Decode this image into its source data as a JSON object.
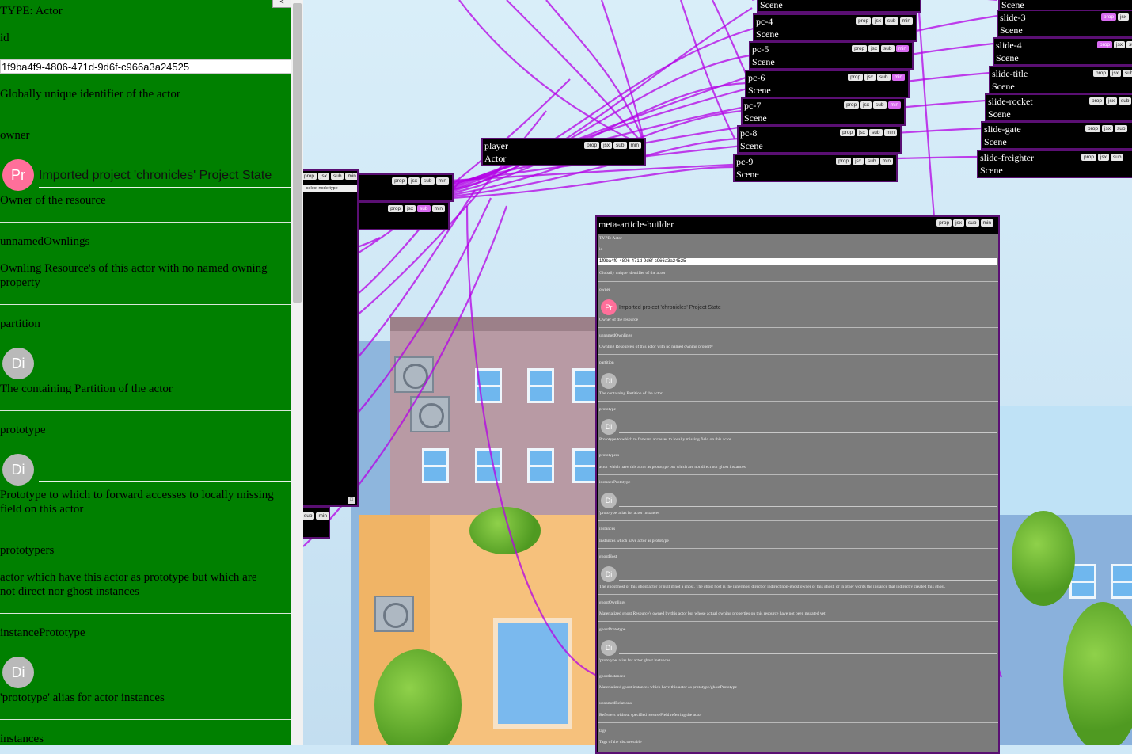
{
  "inspector": {
    "type_label": "TYPE: Actor",
    "collapse_label": "<",
    "id_label": "id",
    "id_value": "1f9ba4f9-4806-471d-9d6f-c966a3a24525",
    "id_desc": "Globally unique identifier of the actor",
    "owner_label": "owner",
    "owner_avatar": "Pr",
    "owner_name": "Imported project 'chronicles' Project State",
    "owner_desc": "Owner of the resource",
    "unnamed_label": "unnamedOwnlings",
    "unnamed_desc_1": "Ownling Resource's of this actor with no named owning",
    "unnamed_desc_2": "property",
    "partition_label": "partition",
    "partition_avatar": "Di",
    "partition_desc": "The containing Partition of the actor",
    "prototype_label": "prototype",
    "prototype_avatar": "Di",
    "prototype_desc_1": "Prototype to which to forward accesses to locally missing",
    "prototype_desc_2": "field on this actor",
    "prototypers_label": "prototypers",
    "prototypers_desc_1": "actor which have this actor as prototype but which are",
    "prototypers_desc_2": "not direct nor ghost instances",
    "instproto_label": "instancePrototype",
    "instproto_avatar": "Di",
    "instproto_desc": "'prototype' alias for actor instances",
    "instances_label": "instances"
  },
  "node_buttons": {
    "prop": "prop",
    "jsx": "jsx",
    "sub": "sub",
    "min": "min"
  },
  "left_node": {
    "select_placeholder": "--select node type--",
    "corner_label": "□"
  },
  "player": {
    "name": "player",
    "type": "Actor"
  },
  "scenes_mid": [
    {
      "name": "",
      "type": "Scene"
    },
    {
      "name": "pc-4",
      "type": "Scene"
    },
    {
      "name": "pc-5",
      "type": "Scene"
    },
    {
      "name": "pc-6",
      "type": "Scene"
    },
    {
      "name": "pc-7",
      "type": "Scene"
    },
    {
      "name": "pc-8",
      "type": "Scene"
    },
    {
      "name": "pc-9",
      "type": "Scene"
    }
  ],
  "scenes_right": [
    {
      "name": "",
      "type": "Scene"
    },
    {
      "name": "slide-3",
      "type": "Scene"
    },
    {
      "name": "slide-4",
      "type": "Scene"
    },
    {
      "name": "slide-title",
      "type": "Scene"
    },
    {
      "name": "slide-rocket",
      "type": "Scene"
    },
    {
      "name": "slide-gate",
      "type": "Scene"
    },
    {
      "name": "slide-freighter",
      "type": "Scene"
    }
  ],
  "mab": {
    "title": "meta-article-builder",
    "type_label": "TYPE: Actor",
    "id_label": "id",
    "id_value": "1f9ba4f9-4806-471d-9d6f-c966a3a24525",
    "id_desc": "Globally unique identifier of the actor",
    "owner_label": "owner",
    "owner_avatar": "Pr",
    "owner_name": "Imported project 'chronicles' Project State",
    "owner_desc": "Owner of the resource",
    "unnamed_label": "unnamedOwnlings",
    "unnamed_desc": "Ownling Resource's of this actor with no named owning property",
    "partition_label": "partition",
    "partition_desc": "The containing Partition of the actor",
    "prototype_label": "prototype",
    "prototype_desc": "Prototype to which to forward accesses to locally missing field on this actor",
    "prototypers_label": "prototypers",
    "prototypers_desc": "actor which have this actor as prototype but which are not direct nor ghost instances",
    "instproto_label": "instancePrototype",
    "instproto_desc": "'prototype' alias for actor instances",
    "instances_label": "instances",
    "instances_desc": "Instances which have actor as prototype",
    "ghosthost_label": "ghostHost",
    "ghosthost_desc": "The ghost host of this ghost actor or null if not a ghost. The ghost host is the innermost direct or indirect non-ghost owner of this ghost, or in other words the instance that indirectly created this ghost.",
    "ghostownlings_label": "ghostOwnlings",
    "ghostownlings_desc": "Materialized ghost Resource's owned by this actor but whose actual owning properties on this resource have not been mutated yet",
    "ghostprototype_label": "ghostPrototype",
    "ghostprototype_desc": "'prototype' alias for actor ghost instances",
    "ghostinstances_label": "ghostInstances",
    "ghostinstances_desc": "Materialized ghost instances which have this actor as prototype/ghostPrototype",
    "unnamedrel_label": "unnamedRelations",
    "unnamedrel_desc": "Referrers without specified reverseField referring the actor",
    "tags_label": "tags",
    "tags_desc": "Tags of the discoverable",
    "avatar_di": "Di"
  },
  "colors": {
    "panel_bg": "#008000",
    "wire": "#b400e6",
    "owner_avatar": "#ff6f9a",
    "di_avatar": "#b9b9b9",
    "node_bg": "#000000"
  }
}
